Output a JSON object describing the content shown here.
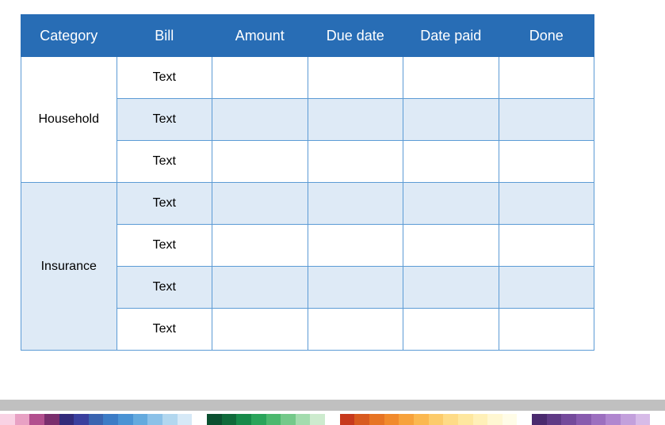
{
  "headers": [
    "Category",
    "Bill",
    "Amount",
    "Due date",
    "Date paid",
    "Done"
  ],
  "categories": [
    {
      "name": "Household",
      "shade": false,
      "rows": [
        {
          "bill": "Text",
          "amount": "",
          "due": "",
          "paid": "",
          "done": "",
          "shade": false
        },
        {
          "bill": "Text",
          "amount": "",
          "due": "",
          "paid": "",
          "done": "",
          "shade": true
        },
        {
          "bill": "Text",
          "amount": "",
          "due": "",
          "paid": "",
          "done": "",
          "shade": false
        }
      ]
    },
    {
      "name": "Insurance",
      "shade": true,
      "rows": [
        {
          "bill": "Text",
          "amount": "",
          "due": "",
          "paid": "",
          "done": "",
          "shade": true
        },
        {
          "bill": "Text",
          "amount": "",
          "due": "",
          "paid": "",
          "done": "",
          "shade": false
        },
        {
          "bill": "Text",
          "amount": "",
          "due": "",
          "paid": "",
          "done": "",
          "shade": true
        },
        {
          "bill": "Text",
          "amount": "",
          "due": "",
          "paid": "",
          "done": "",
          "shade": false
        }
      ]
    }
  ],
  "palette": [
    "#f9d2e4",
    "#e8a1c4",
    "#b24f8e",
    "#7a2e6d",
    "#322a7a",
    "#3a3f9e",
    "#3a64b0",
    "#3c7cc6",
    "#4a93d4",
    "#64aade",
    "#8bc1e8",
    "#b2d7ef",
    "#d6e9f7",
    "#ffffff",
    "#0b5030",
    "#0f6a3a",
    "#178a4a",
    "#2aa45a",
    "#4cb86e",
    "#74c98a",
    "#a3dcae",
    "#cdebce",
    "#ffffff",
    "#c73a1d",
    "#d85a1f",
    "#e77424",
    "#f18a2c",
    "#f7a23c",
    "#fbb850",
    "#fccb6b",
    "#fedb87",
    "#fee79f",
    "#fff0b8",
    "#fff7d2",
    "#fffce7",
    "#ffffff",
    "#4a2a6e",
    "#5f3a85",
    "#744a9b",
    "#885bae",
    "#9c6fbf",
    "#b086cf",
    "#c3a0dc",
    "#d7bbe8",
    "#ffffff"
  ]
}
